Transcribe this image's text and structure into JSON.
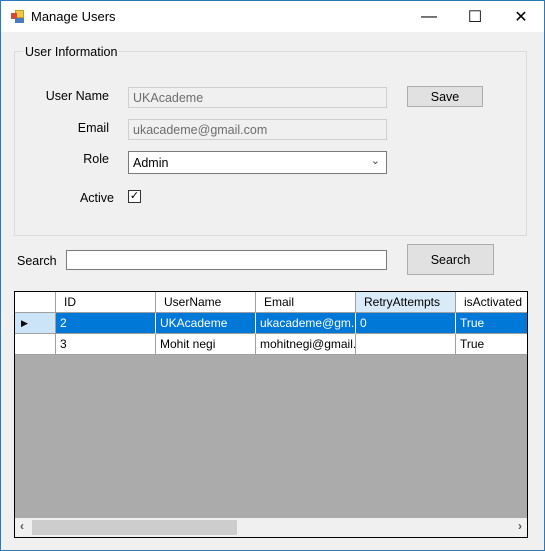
{
  "window": {
    "title": "Manage Users",
    "controls": {
      "minimize": "—",
      "maximize": "☐",
      "close": "✕"
    }
  },
  "user_info": {
    "group_label": "User Information",
    "username_label": "User Name",
    "username_value": "UKAcademe",
    "email_label": "Email",
    "email_value": "ukacademe@gmail.com",
    "role_label": "Role",
    "role_value": "Admin",
    "active_label": "Active",
    "active_checked": true,
    "save_label": "Save"
  },
  "search": {
    "label": "Search",
    "value": "",
    "button_label": "Search"
  },
  "grid": {
    "columns": [
      "ID",
      "UserName",
      "Email",
      "RetryAttempts",
      "isActivated"
    ],
    "rows": [
      {
        "selected": true,
        "cells": [
          "2",
          "UKAcademe",
          "ukacademe@gm...",
          "0",
          "True"
        ]
      },
      {
        "selected": false,
        "cells": [
          "3",
          "Mohit negi",
          "mohitnegi@gmail....",
          "",
          "True"
        ]
      }
    ],
    "current_row_indicator": "▶",
    "scroll": {
      "left": "‹",
      "right": "›"
    }
  }
}
